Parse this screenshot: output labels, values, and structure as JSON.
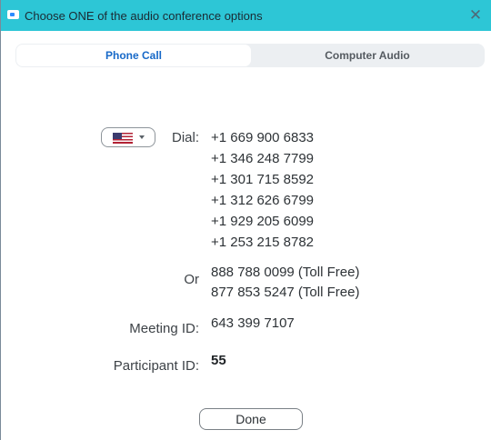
{
  "window": {
    "title": "Choose ONE of the audio conference options",
    "close_glyph": "✕",
    "accent_color": "#2dc6d6"
  },
  "tabs": [
    {
      "label": "Phone Call",
      "active": true
    },
    {
      "label": "Computer Audio",
      "active": false
    }
  ],
  "country_selector": {
    "selected": "United States",
    "icon": "us-flag-icon"
  },
  "dial": {
    "label": "Dial:",
    "numbers": [
      "+1 669 900 6833",
      "+1 346 248 7799",
      "+1 301 715 8592",
      "+1 312 626 6799",
      "+1 929 205 6099",
      "+1 253 215 8782"
    ]
  },
  "toll_free": {
    "label": "Or",
    "numbers": [
      "888 788 0099 (Toll Free)",
      "877 853 5247 (Toll Free)"
    ]
  },
  "meeting": {
    "label": "Meeting ID:",
    "value": "643 399 7107"
  },
  "participant": {
    "label": "Participant ID:",
    "value": "55"
  },
  "done_label": "Done"
}
